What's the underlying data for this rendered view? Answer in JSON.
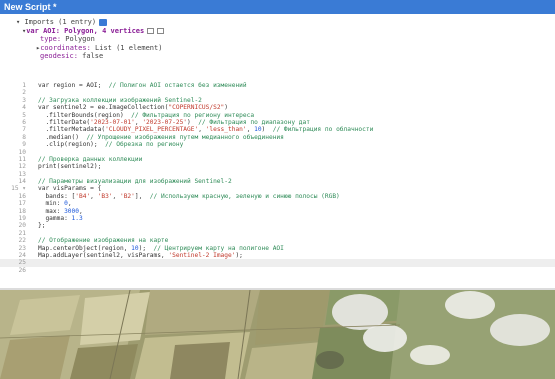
{
  "window": {
    "title": "New Script *"
  },
  "imports": {
    "header": "Imports (1 entry)",
    "var_line": "var AOI: Polygon, 4 vertices",
    "type_label": "type:",
    "type_value": "Polygon",
    "coords_label": "coordinates:",
    "coords_value": "List (1 element)",
    "geodesic_label": "geodesic:",
    "geodesic_value": "false"
  },
  "code_lines": [
    {
      "num": "1",
      "segs": [
        [
          "",
          "var region = AOI;  "
        ],
        [
          "c",
          "// Полигон AOI остается без изменений"
        ]
      ]
    },
    {
      "num": "2",
      "segs": []
    },
    {
      "num": "3",
      "segs": [
        [
          "c",
          "// Загрузка коллекции изображений Sentinel-2"
        ]
      ]
    },
    {
      "num": "4",
      "segs": [
        [
          "",
          "var sentinel2 = ee.ImageCollection("
        ],
        [
          "s",
          "\"COPERNICUS/S2\""
        ],
        [
          "",
          ")"
        ]
      ]
    },
    {
      "num": "5",
      "segs": [
        [
          "",
          "  .filterBounds(region)  "
        ],
        [
          "c",
          "// Фильтрация по региону интереса"
        ]
      ]
    },
    {
      "num": "6",
      "segs": [
        [
          "",
          "  .filterDate("
        ],
        [
          "s",
          "'2023-07-01'"
        ],
        [
          "",
          ", "
        ],
        [
          "s",
          "'2023-07-25'"
        ],
        [
          "",
          ")  "
        ],
        [
          "c",
          "// Фильтрация по диапазону дат"
        ]
      ]
    },
    {
      "num": "7",
      "segs": [
        [
          "",
          "  .filterMetadata("
        ],
        [
          "s",
          "'CLOUDY_PIXEL_PERCENTAGE'"
        ],
        [
          "",
          ", "
        ],
        [
          "s",
          "'less_than'"
        ],
        [
          "",
          ", "
        ],
        [
          "n",
          "10"
        ],
        [
          "",
          ")  "
        ],
        [
          "c",
          "// Фильтрация по облачности"
        ]
      ]
    },
    {
      "num": "8",
      "segs": [
        [
          "",
          "  .median()  "
        ],
        [
          "c",
          "// Упрощение изображения путем медианного объединения"
        ]
      ]
    },
    {
      "num": "9",
      "segs": [
        [
          "",
          "  .clip(region);  "
        ],
        [
          "c",
          "// Обрезка по региону"
        ]
      ]
    },
    {
      "num": "10",
      "segs": []
    },
    {
      "num": "11",
      "segs": [
        [
          "c",
          "// Проверка данных коллекции"
        ]
      ]
    },
    {
      "num": "12",
      "segs": [
        [
          "",
          "print(sentinel2);"
        ]
      ]
    },
    {
      "num": "13",
      "segs": []
    },
    {
      "num": "14",
      "segs": [
        [
          "c",
          "// Параметры визуализации для изображений Sentinel-2"
        ]
      ]
    },
    {
      "num": "15 ▾",
      "segs": [
        [
          "",
          "var visParams = {"
        ]
      ]
    },
    {
      "num": "16",
      "segs": [
        [
          "",
          "  bands: ["
        ],
        [
          "s",
          "'B4'"
        ],
        [
          "",
          ", "
        ],
        [
          "s",
          "'B3'"
        ],
        [
          "",
          ", "
        ],
        [
          "s",
          "'B2'"
        ],
        [
          "",
          "],  "
        ],
        [
          "c",
          "// Используем красную, зеленую и синюю полосы (RGB)"
        ]
      ]
    },
    {
      "num": "17",
      "segs": [
        [
          "",
          "  min: "
        ],
        [
          "n",
          "0"
        ],
        [
          "",
          ","
        ]
      ]
    },
    {
      "num": "18",
      "segs": [
        [
          "",
          "  max: "
        ],
        [
          "n",
          "3000"
        ],
        [
          "",
          ","
        ]
      ]
    },
    {
      "num": "19",
      "segs": [
        [
          "",
          "  gamma: "
        ],
        [
          "n",
          "1.3"
        ]
      ]
    },
    {
      "num": "20",
      "segs": [
        [
          "",
          "};"
        ]
      ]
    },
    {
      "num": "21",
      "segs": []
    },
    {
      "num": "22",
      "segs": [
        [
          "c",
          "// Отображение изображения на карте"
        ]
      ]
    },
    {
      "num": "23",
      "segs": [
        [
          "",
          "Map.centerObject(region, "
        ],
        [
          "n",
          "10"
        ],
        [
          "",
          ");  "
        ],
        [
          "c",
          "// Центрируем карту на полигоне AOI"
        ]
      ]
    },
    {
      "num": "24",
      "segs": [
        [
          "",
          "Map.addLayer(sentinel2, visParams, "
        ],
        [
          "s",
          "'Sentinel-2 Image'"
        ],
        [
          "",
          ");"
        ]
      ]
    },
    {
      "num": "25",
      "segs": [],
      "active": true
    },
    {
      "num": "26",
      "segs": []
    }
  ],
  "colors": {
    "titlebar": "#3a7bd5",
    "comment": "#2e8b57",
    "string": "#c0392b",
    "number": "#1a56db"
  },
  "icons": [
    "expand-icon",
    "checkbox-icon",
    "layer-icon"
  ]
}
